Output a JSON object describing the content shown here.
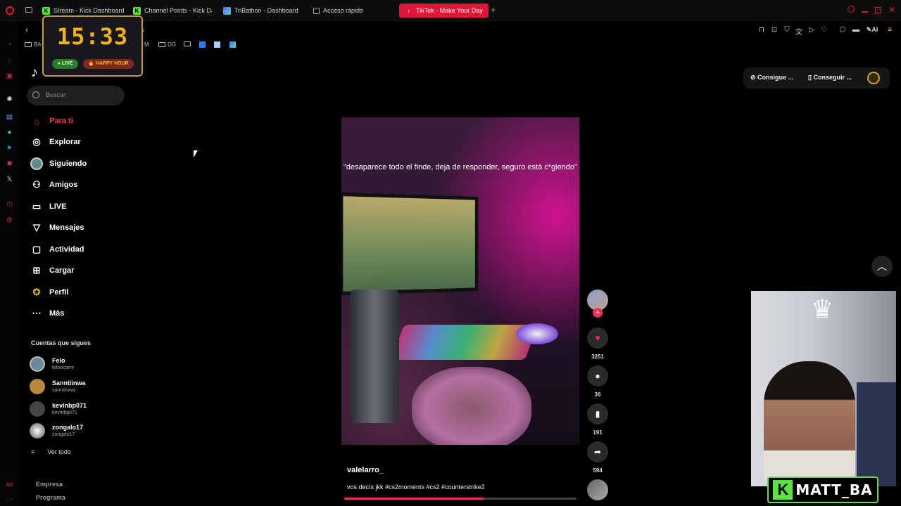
{
  "browser": {
    "tabs": [
      {
        "label": "Stream - Kick Dashboard",
        "icon": "kick-icon"
      },
      {
        "label": "Channel Points - Kick Das",
        "icon": "kick-icon"
      },
      {
        "label": "TriBathon - Dashboard",
        "icon": "tribathon-icon"
      },
      {
        "label": "Acceso rápido",
        "icon": "grid-icon"
      },
      {
        "label": "TikTok - Make Your Day",
        "icon": "tiktok-icon",
        "active": true
      }
    ],
    "bookmarks": [
      "BA",
      "M",
      "DG"
    ],
    "ai_label": "AI",
    "sidebar_bottom": "GX"
  },
  "overlay_clock": {
    "time": "15:33",
    "live": "● LIVE",
    "happy_hour": "🔥 HAPPY HOUR"
  },
  "tiktok": {
    "search_placeholder": "Buscar",
    "nav": [
      {
        "label": "Para ti",
        "icon": "home-icon",
        "active": true
      },
      {
        "label": "Explorar",
        "icon": "compass-icon"
      },
      {
        "label": "Siguiendo",
        "icon": "avatar-icon"
      },
      {
        "label": "Amigos",
        "icon": "friends-icon"
      },
      {
        "label": "LIVE",
        "icon": "live-icon"
      },
      {
        "label": "Mensajes",
        "icon": "send-icon"
      },
      {
        "label": "Actividad",
        "icon": "activity-icon"
      },
      {
        "label": "Cargar",
        "icon": "upload-icon"
      },
      {
        "label": "Perfil",
        "icon": "profile-icon"
      },
      {
        "label": "Más",
        "icon": "more-icon"
      }
    ],
    "following_title": "Cuentas que sigues",
    "following": [
      {
        "name": "Felo",
        "handle": "feloocarre",
        "color": "#6a8a9a"
      },
      {
        "name": "Sanntiinwa",
        "handle": "sanntiinwa",
        "color": "#b88a3a"
      },
      {
        "name": "kevinbp071",
        "handle": "kevinbp071",
        "color": "#444"
      },
      {
        "name": "zongalo17",
        "handle": "zongalo17",
        "color": "#ddd"
      }
    ],
    "see_all": "Ver todo",
    "footer": [
      "Empresa",
      "Programa"
    ],
    "top_buttons": [
      "Consigue ...",
      "Conseguir ..."
    ],
    "video": {
      "caption": "\"desaparece todo el finde, deja de responder, seguro está c*giendo\"",
      "author": "valelarro_",
      "description": "vos decís jkk #cs2moments #cs2 #counterstrike2",
      "progress": 0.6,
      "likes": "3251",
      "comments": "36",
      "saves": "191",
      "shares": "594"
    }
  },
  "stream": {
    "brand": "MATT_BA",
    "brand_k": "K"
  },
  "colors": {
    "accent": "#fe2c55",
    "opera_red": "#e0153a",
    "kick_green": "#57e63f",
    "clock_gold": "#f2b31c"
  }
}
